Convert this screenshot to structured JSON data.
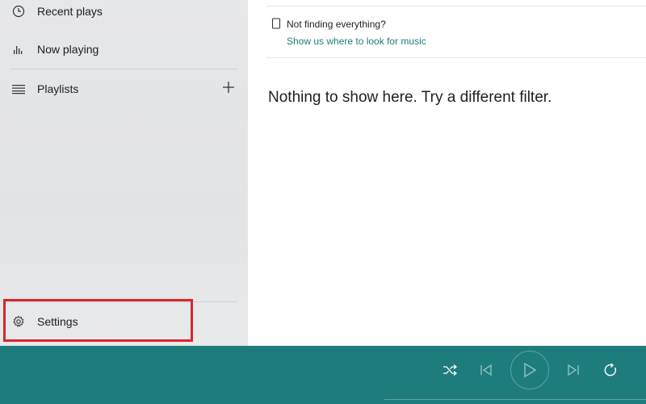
{
  "sidebar": {
    "items": [
      {
        "label": "Recent plays",
        "icon": "clock-icon"
      },
      {
        "label": "Now playing",
        "icon": "equalizer-icon"
      },
      {
        "label": "Playlists",
        "icon": "playlist-icon"
      }
    ],
    "add_icon": "plus-icon",
    "settings": {
      "label": "Settings",
      "icon": "gear-icon"
    }
  },
  "main": {
    "notice": {
      "title": "Not finding everything?",
      "link": "Show us where to look for music"
    },
    "empty_message": "Nothing to show here. Try a different filter."
  },
  "player": {
    "controls": [
      "shuffle-icon",
      "previous-icon",
      "play-icon",
      "next-icon",
      "repeat-icon"
    ]
  },
  "colors": {
    "accent": "#1a7f7a",
    "player_bar": "#1e7c7c",
    "highlight": "#d7262d"
  }
}
